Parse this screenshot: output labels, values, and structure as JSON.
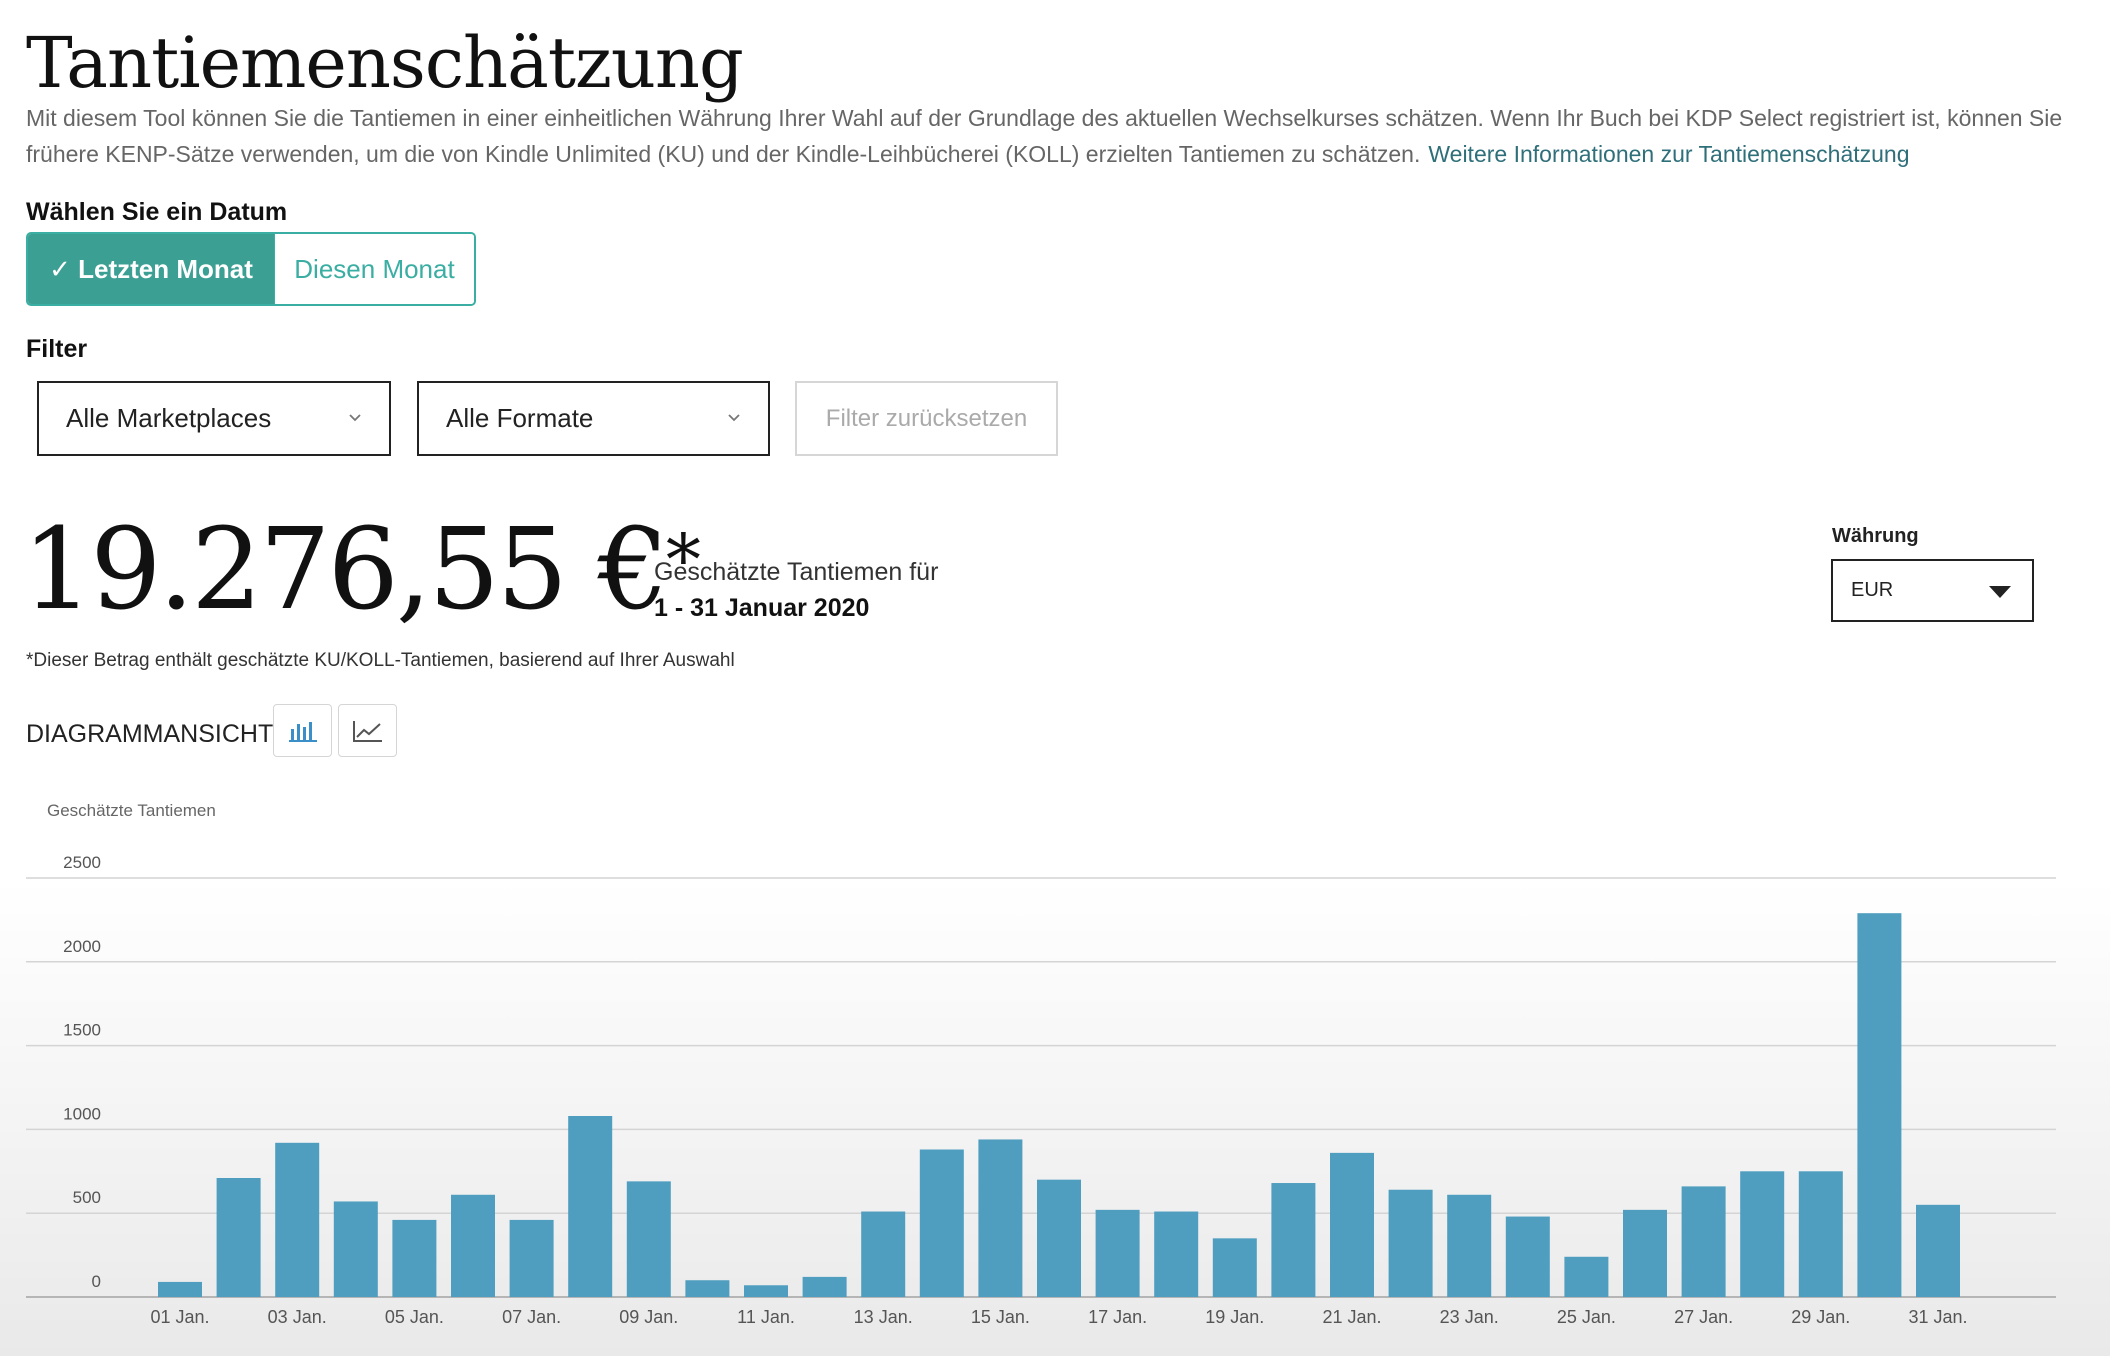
{
  "header": {
    "title": "Tantiemenschätzung",
    "intro_line1": "Mit diesem Tool können Sie die Tantiemen in einer einheitlichen Währung Ihrer Wahl auf der Grundlage des aktuellen Wechselkurses schätzen. Wenn Ihr Buch bei KDP Select registriert ist, können Sie frühere KENP-Sätze verwenden, um die von Kindle Unlimited (KU) und der Kindle-Leihbücherei (KOLL) erzielten Tantiemen zu schätzen.",
    "intro_link": "Weitere Informationen zur Tantiemenschätzung"
  },
  "date_selector": {
    "label": "Wählen Sie ein Datum",
    "options": [
      "✓ Letzten Monat",
      "Diesen Monat"
    ],
    "selected": "✓ Letzten Monat"
  },
  "filter": {
    "label": "Filter",
    "marketplace": "Alle Marketplaces",
    "format": "Alle Formate",
    "reset_label": "Filter zurücksetzen"
  },
  "summary": {
    "amount": "19.276,55 €",
    "asterisk": "*",
    "estimate_label": "Geschätzte Tantiemen für",
    "period": "1 - 31 Januar 2020",
    "footnote": "*Dieser Betrag enthält geschätzte KU/KOLL-Tantiemen, basierend auf Ihrer Auswahl"
  },
  "currency": {
    "label": "Währung",
    "selected": "EUR"
  },
  "chart_view": {
    "label": "DIAGRAMMANSICHT",
    "icons": [
      "bar-chart-icon",
      "line-chart-icon"
    ],
    "active": "bar-chart-icon"
  },
  "colors": {
    "accent": "#3c9f94",
    "bar": "#4f9ebf",
    "link": "#2f6f7a"
  },
  "chart_data": {
    "type": "bar",
    "ylabel": "Geschätzte Tantiemen",
    "ylim": [
      0,
      2500
    ],
    "yticks": [
      0,
      500,
      1000,
      1500,
      2000,
      2500
    ],
    "grid": true,
    "categories": [
      "01 Jan.",
      "02 Jan.",
      "03 Jan.",
      "04 Jan.",
      "05 Jan.",
      "06 Jan.",
      "07 Jan.",
      "08 Jan.",
      "09 Jan.",
      "10 Jan.",
      "11 Jan.",
      "12 Jan.",
      "13 Jan.",
      "14 Jan.",
      "15 Jan.",
      "16 Jan.",
      "17 Jan.",
      "18 Jan.",
      "19 Jan.",
      "20 Jan.",
      "21 Jan.",
      "22 Jan.",
      "23 Jan.",
      "24 Jan.",
      "25 Jan.",
      "26 Jan.",
      "27 Jan.",
      "28 Jan.",
      "29 Jan.",
      "30 Jan.",
      "31 Jan."
    ],
    "tick_labels": [
      "01 Jan.",
      "",
      "03 Jan.",
      "",
      "05 Jan.",
      "",
      "07 Jan.",
      "",
      "09 Jan.",
      "",
      "11 Jan.",
      "",
      "13 Jan.",
      "",
      "15 Jan.",
      "",
      "17 Jan.",
      "",
      "19 Jan.",
      "",
      "21 Jan.",
      "",
      "23 Jan.",
      "",
      "25 Jan.",
      "",
      "27 Jan.",
      "",
      "29 Jan.",
      "",
      "31 Jan."
    ],
    "values": [
      90,
      710,
      920,
      570,
      460,
      610,
      460,
      1080,
      690,
      100,
      70,
      120,
      510,
      880,
      940,
      700,
      520,
      510,
      350,
      680,
      860,
      640,
      610,
      480,
      240,
      520,
      660,
      750,
      750,
      2290,
      550
    ]
  }
}
